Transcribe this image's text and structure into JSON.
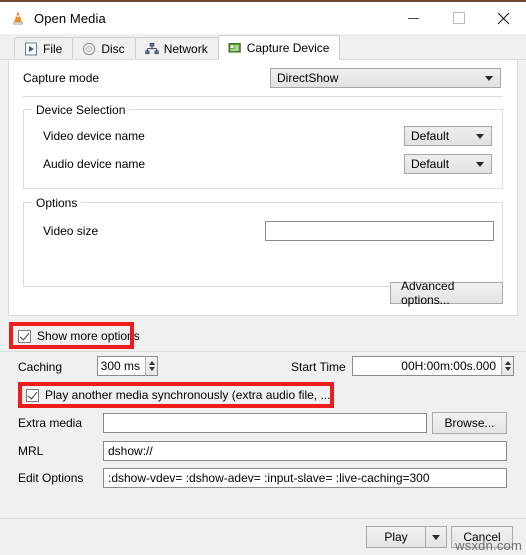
{
  "window": {
    "title": "Open Media",
    "app_icon": "vlc-cone-icon",
    "controls": {
      "minimize": "minimize-icon",
      "maximize": "maximize-icon",
      "close": "close-icon"
    }
  },
  "tabs": [
    {
      "label": "File",
      "icon": "file-icon",
      "active": false
    },
    {
      "label": "Disc",
      "icon": "disc-icon",
      "active": false
    },
    {
      "label": "Network",
      "icon": "network-icon",
      "active": false
    },
    {
      "label": "Capture Device",
      "icon": "capture-device-icon",
      "active": true
    }
  ],
  "capture": {
    "mode_label": "Capture mode",
    "mode_value": "DirectShow",
    "device_selection": {
      "legend": "Device Selection",
      "video_label": "Video device name",
      "video_value": "Default",
      "audio_label": "Audio device name",
      "audio_value": "Default"
    },
    "options": {
      "legend": "Options",
      "video_size_label": "Video size",
      "video_size_value": "",
      "video_size_placeholder": ""
    },
    "advanced_button": "Advanced options..."
  },
  "more_options": {
    "show_more_label": "Show more options",
    "show_more_checked": true,
    "caching_label": "Caching",
    "caching_value": "300 ms",
    "start_time_label": "Start Time",
    "start_time_value": "00H:00m:00s.000",
    "sync_label": "Play another media synchronously (extra audio file, ...)",
    "sync_checked": true,
    "extra_media_label": "Extra media",
    "extra_media_value": "",
    "browse_button": "Browse...",
    "mrl_label": "MRL",
    "mrl_value": "dshow://",
    "edit_options_label": "Edit Options",
    "edit_options_value": ":dshow-vdev= :dshow-adev=  :input-slave= :live-caching=300"
  },
  "footer": {
    "play_button": "Play",
    "play_dropdown": "chevron-down-icon",
    "cancel_button": "Cancel"
  },
  "watermark": "wsxdn.com",
  "colors": {
    "highlight": "#ee1c1c",
    "titlebar_accent": "#6b4a2f",
    "window_bg": "#f0f0f0",
    "page_bg": "#ffffff"
  }
}
